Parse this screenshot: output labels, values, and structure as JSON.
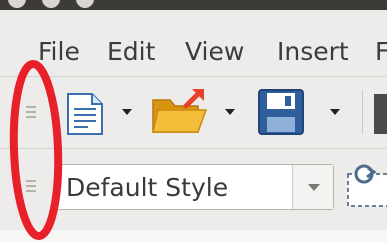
{
  "menu": {
    "items": [
      "File",
      "Edit",
      "View",
      "Insert",
      "F"
    ]
  },
  "toolbar": {
    "icons": [
      "new-document-icon",
      "open-folder-icon",
      "save-floppy-icon",
      "insert-icon"
    ]
  },
  "formatting": {
    "paragraph_style": "Default Style",
    "icons": [
      "chevron-down-icon",
      "style-update-icon"
    ]
  },
  "colors": {
    "annotation": "#e8202a",
    "background": "#edecea",
    "folder": "#f2b01e",
    "save_blue": "#2f5e9a"
  }
}
